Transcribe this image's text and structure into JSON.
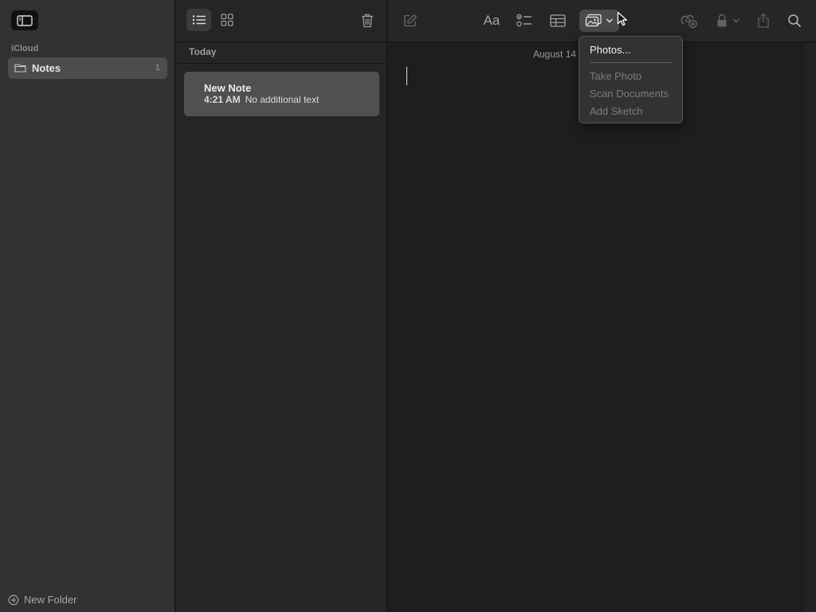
{
  "sidebar": {
    "section_label": "iCloud",
    "folders": [
      {
        "name": "Notes",
        "count": "1"
      }
    ],
    "new_folder_label": "New Folder"
  },
  "note_list": {
    "group_label": "Today",
    "notes": [
      {
        "title": "New Note",
        "time": "4:21 AM",
        "preview": "No additional text"
      }
    ]
  },
  "editor": {
    "date": "August 14",
    "format_label": "Aa"
  },
  "media_menu": {
    "items": [
      {
        "label": "Photos...",
        "enabled": true
      },
      {
        "label": "Take Photo",
        "enabled": false
      },
      {
        "label": "Scan Documents",
        "enabled": false
      },
      {
        "label": "Add Sketch",
        "enabled": false
      }
    ]
  },
  "icons": {
    "sidebar_toggle": "sidebar-icon",
    "folder": "folder-icon",
    "new_folder": "plus-circle-icon",
    "list_view": "list-icon",
    "gallery_view": "grid-icon",
    "trash": "trash-icon",
    "compose": "compose-icon",
    "checklist": "checklist-icon",
    "table": "table-icon",
    "media": "photo-icon",
    "collaborate": "collaborate-icon",
    "lock": "lock-icon",
    "share": "share-icon",
    "search": "search-icon"
  },
  "colors": {
    "sidebar_bg": "#323232",
    "list_bg": "#252525",
    "editor_bg": "#1e1e1e",
    "selected_note": "#505050",
    "selected_folder": "#4d4d4d"
  }
}
